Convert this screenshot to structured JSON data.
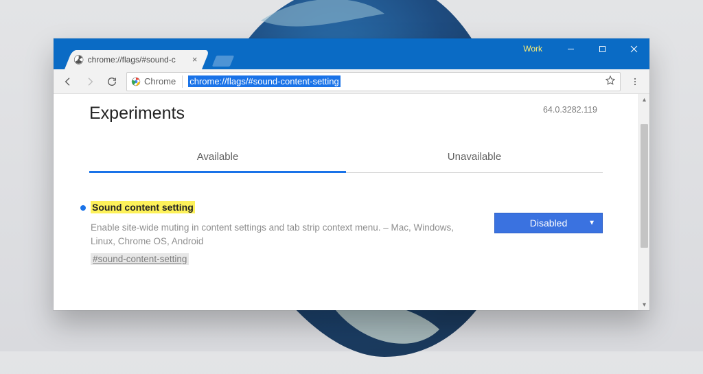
{
  "window": {
    "work_label": "Work"
  },
  "tab": {
    "title": "chrome://flags/#sound-c"
  },
  "omnibox": {
    "chip_label": "Chrome",
    "url": "chrome://flags/#sound-content-setting"
  },
  "page": {
    "title": "Experiments",
    "version": "64.0.3282.119",
    "tabs": {
      "available": "Available",
      "unavailable": "Unavailable"
    }
  },
  "flag": {
    "title": "Sound content setting",
    "description": "Enable site-wide muting in content settings and tab strip context menu. – Mac, Windows, Linux, Chrome OS, Android",
    "anchor": "#sound-content-setting",
    "select_value": "Disabled"
  }
}
